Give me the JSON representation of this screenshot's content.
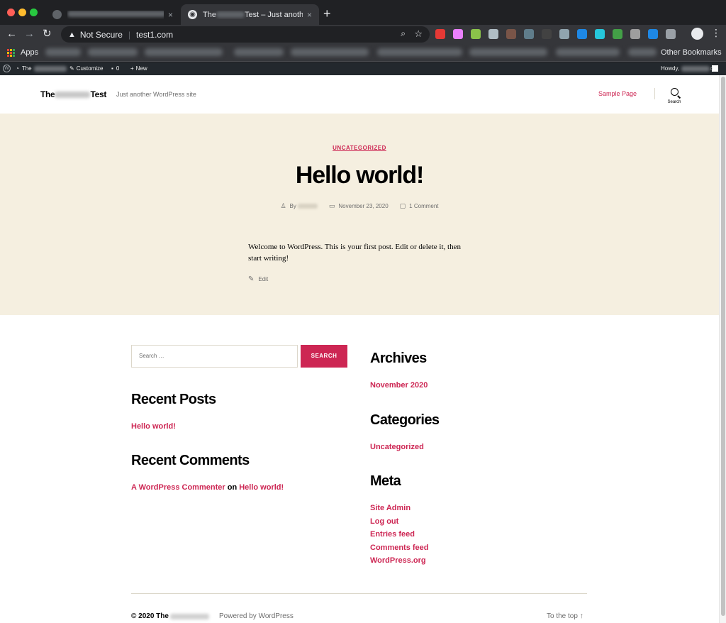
{
  "browser": {
    "tabs": [
      {
        "title": "",
        "active": false
      },
      {
        "title_prefix": "The",
        "title_suffix": "Test – Just another",
        "active": true
      }
    ],
    "new_tab_label": "+",
    "close_label": "×",
    "address": {
      "security_label": "Not Secure",
      "url": "test1.com"
    },
    "extension_colors": [
      "#e53935",
      "#ea80fc",
      "#8bc34a",
      "#b0bec5",
      "#795548",
      "#607d8b",
      "#424242",
      "#90a4ae",
      "#1e88e5",
      "#26c6da",
      "#43a047",
      "#9e9e9e",
      "#1e88e5",
      "#9aa0a6"
    ],
    "bookmarks": {
      "apps_label": "Apps",
      "other_label": "Other Bookmarks"
    }
  },
  "admin_bar": {
    "site_prefix": "The",
    "customize_label": "Customize",
    "comments_count": "0",
    "new_label": "New",
    "howdy_label": "Howdy,"
  },
  "site": {
    "title_prefix": "The",
    "title_suffix": "Test",
    "description": "Just another WordPress site",
    "menu": [
      "Sample Page"
    ],
    "search_label": "Search"
  },
  "post": {
    "category": "UNCATEGORIZED",
    "title": "Hello world!",
    "author_prefix": "By",
    "date": "November 23, 2020",
    "comments": "1 Comment",
    "body": "Welcome to WordPress. This is your first post. Edit or delete it, then start writing!",
    "edit_label": "Edit"
  },
  "widgets": {
    "search": {
      "placeholder": "Search …",
      "button": "SEARCH"
    },
    "recent_posts": {
      "title": "Recent Posts",
      "items": [
        "Hello world!"
      ]
    },
    "recent_comments": {
      "title": "Recent Comments",
      "author": "A WordPress Commenter",
      "connector": "on",
      "post": "Hello world!"
    },
    "archives": {
      "title": "Archives",
      "items": [
        "November 2020"
      ]
    },
    "categories": {
      "title": "Categories",
      "items": [
        "Uncategorized"
      ]
    },
    "meta": {
      "title": "Meta",
      "items": [
        "Site Admin",
        "Log out",
        "Entries feed",
        "Comments feed",
        "WordPress.org"
      ]
    }
  },
  "footer": {
    "copyright_prefix": "© 2020 The",
    "powered": "Powered by WordPress",
    "to_top": "To the top ↑"
  },
  "colors": {
    "accent": "#cd2653",
    "hero_bg": "#f5efe0",
    "admin_bar": "#23282d"
  }
}
